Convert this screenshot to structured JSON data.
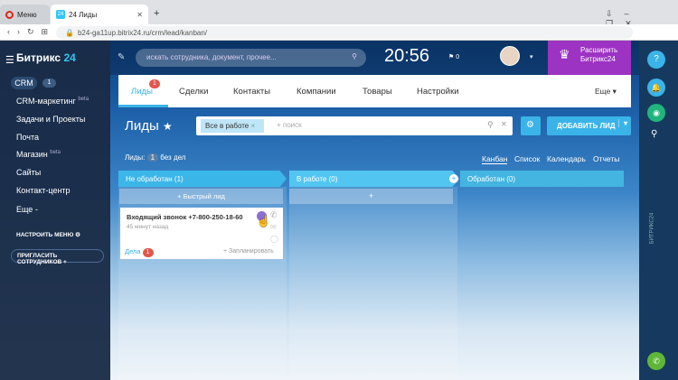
{
  "browser": {
    "tab1": "Меню",
    "tab2": "24 Лиды",
    "new_tab": "+",
    "url": "b24-ga11up.bitrix24.ru/crm/lead/kanban/"
  },
  "leftmenu": {
    "logo_a": "Битрикс",
    "logo_b": "24",
    "crm": "CRM",
    "crm_count": "1",
    "items": [
      "CRM-маркетинг",
      "Задачи и Проекты",
      "Почта",
      "Магазин",
      "Сайты",
      "Контакт-центр",
      "Еще -"
    ],
    "beta": "beta",
    "setup": "НАСТРОИТЬ МЕНЮ",
    "invite": "ПРИГЛАСИТЬ СОТРУДНИКОВ"
  },
  "header": {
    "search_placeholder": "искать сотрудника, документ, прочее...",
    "time": "20:56",
    "flag_count": "0",
    "expand_line1": "Расширить",
    "expand_line2": "Битрикс24"
  },
  "nav": {
    "tabs": [
      "Лиды",
      "Сделки",
      "Контакты",
      "Компании",
      "Товары",
      "Настройки"
    ],
    "more": "Еще",
    "leads_badge": "1"
  },
  "page": {
    "title": "Лиды",
    "filter_chip": "Все в работе",
    "filter_search": "+ поиск",
    "add_button": "ДОБАВИТЬ ЛИД",
    "leads_label": "Лиды:",
    "leads_count": "1",
    "no_deals": "без дел",
    "views": [
      "Канбан",
      "Список",
      "Календарь",
      "Отчеты"
    ]
  },
  "kanban": {
    "columns": [
      {
        "title": "Не обработан",
        "count": "(1)",
        "color": "#3bb6e8"
      },
      {
        "title": "В работе",
        "count": "(0)",
        "color": "#52c6f0"
      },
      {
        "title": "Обработан",
        "count": "(0)",
        "color": "#43b5e0"
      }
    ],
    "quick_add": "+ Быстрый лид",
    "plus": "+",
    "card": {
      "title": "Входящий звонок +7-800-250-18-60",
      "time": "45 минут назад",
      "deals": "Дела",
      "deals_count": "1",
      "planned": "+ Запланировать"
    }
  },
  "rightbar": {
    "vertical_label": "БИТРИКС24"
  },
  "colors": {
    "accent": "#3ab3e8",
    "brand_purple": "#9c33c2",
    "badge_red": "#e2564b"
  }
}
